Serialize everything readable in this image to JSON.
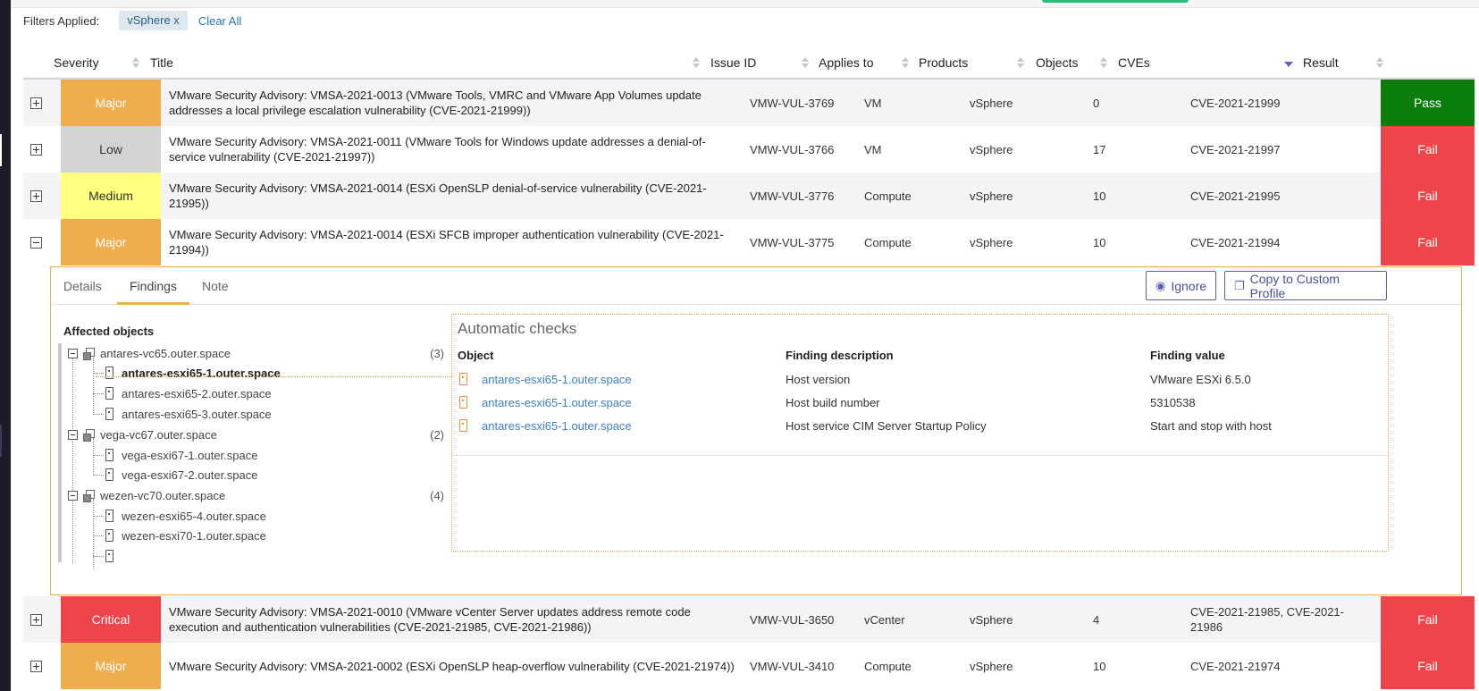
{
  "filters": {
    "label": "Filters Applied:",
    "chip": "vSphere x",
    "clear": "Clear All"
  },
  "columns": {
    "severity": "Severity",
    "title": "Title",
    "issue_id": "Issue ID",
    "applies_to": "Applies to",
    "products": "Products",
    "objects": "Objects",
    "cves": "CVEs",
    "result": "Result"
  },
  "rows": [
    {
      "severity": "Major",
      "title": "VMware Security Advisory: VMSA-2021-0013 (VMware Tools, VMRC and VMware App Volumes update addresses a local privilege escalation vulnerability (CVE-2021-21999))",
      "issue_id": "VMW-VUL-3769",
      "applies_to": "VM",
      "products": "vSphere",
      "objects": "0",
      "cves": "CVE-2021-21999",
      "result": "Pass"
    },
    {
      "severity": "Low",
      "title": "VMware Security Advisory: VMSA-2021-0011 (VMware Tools for Windows update addresses a denial-of-service vulnerability (CVE-2021-21997))",
      "issue_id": "VMW-VUL-3766",
      "applies_to": "VM",
      "products": "vSphere",
      "objects": "17",
      "cves": "CVE-2021-21997",
      "result": "Fail"
    },
    {
      "severity": "Medium",
      "title": "VMware Security Advisory: VMSA-2021-0014 (ESXi OpenSLP denial-of-service vulnerability (CVE-2021-21995))",
      "issue_id": "VMW-VUL-3776",
      "applies_to": "Compute",
      "products": "vSphere",
      "objects": "10",
      "cves": "CVE-2021-21995",
      "result": "Fail"
    },
    {
      "severity": "Major",
      "title": "VMware Security Advisory: VMSA-2021-0014 (ESXi SFCB improper authentication vulnerability (CVE-2021-21994))",
      "issue_id": "VMW-VUL-3775",
      "applies_to": "Compute",
      "products": "vSphere",
      "objects": "10",
      "cves": "CVE-2021-21994",
      "result": "Fail"
    },
    {
      "severity": "Critical",
      "title": "VMware Security Advisory: VMSA-2021-0010 (VMware vCenter Server updates address remote code execution and authentication vulnerabilities (CVE-2021-21985, CVE-2021-21986))",
      "issue_id": "VMW-VUL-3650",
      "applies_to": "vCenter",
      "products": "vSphere",
      "objects": "4",
      "cves": "CVE-2021-21985, CVE-2021-21986",
      "result": "Fail"
    },
    {
      "severity": "Major",
      "title": "VMware Security Advisory: VMSA-2021-0002 (ESXi OpenSLP heap-overflow vulnerability (CVE-2021-21974))",
      "issue_id": "VMW-VUL-3410",
      "applies_to": "Compute",
      "products": "vSphere",
      "objects": "10",
      "cves": "CVE-2021-21974",
      "result": "Fail"
    }
  ],
  "detail": {
    "tabs": [
      "Details",
      "Findings",
      "Note"
    ],
    "ignore_label": "Ignore",
    "copy_label": "Copy to Custom Profile",
    "affected_title": "Affected objects",
    "tree": [
      {
        "name": "antares-vc65.outer.space",
        "count": "(3)",
        "hosts": [
          "antares-esxi65-1.outer.space",
          "antares-esxi65-2.outer.space",
          "antares-esxi65-3.outer.space"
        ]
      },
      {
        "name": "vega-vc67.outer.space",
        "count": "(2)",
        "hosts": [
          "vega-esxi67-1.outer.space",
          "vega-esxi67-2.outer.space"
        ]
      },
      {
        "name": "wezen-vc70.outer.space",
        "count": "(4)",
        "hosts": [
          "wezen-esxi65-4.outer.space",
          "wezen-esxi70-1.outer.space"
        ]
      }
    ],
    "auto_title": "Automatic checks",
    "auto_cols": {
      "object": "Object",
      "desc": "Finding description",
      "value": "Finding value"
    },
    "checks": [
      {
        "object": "antares-esxi65-1.outer.space",
        "desc": "Host version",
        "value": "VMware ESXi 6.5.0"
      },
      {
        "object": "antares-esxi65-1.outer.space",
        "desc": "Host build number",
        "value": "5310538"
      },
      {
        "object": "antares-esxi65-1.outer.space",
        "desc": "Host service CIM Server Startup Policy",
        "value": "Start and stop with host"
      }
    ]
  },
  "colors": {
    "major": "#f0ad4e",
    "low": "#d3d3d3",
    "medium": "#ffff80",
    "critical": "#f0444b",
    "pass": "#0b7d0b",
    "fail": "#f0444b",
    "accent": "#5b5fa8"
  }
}
